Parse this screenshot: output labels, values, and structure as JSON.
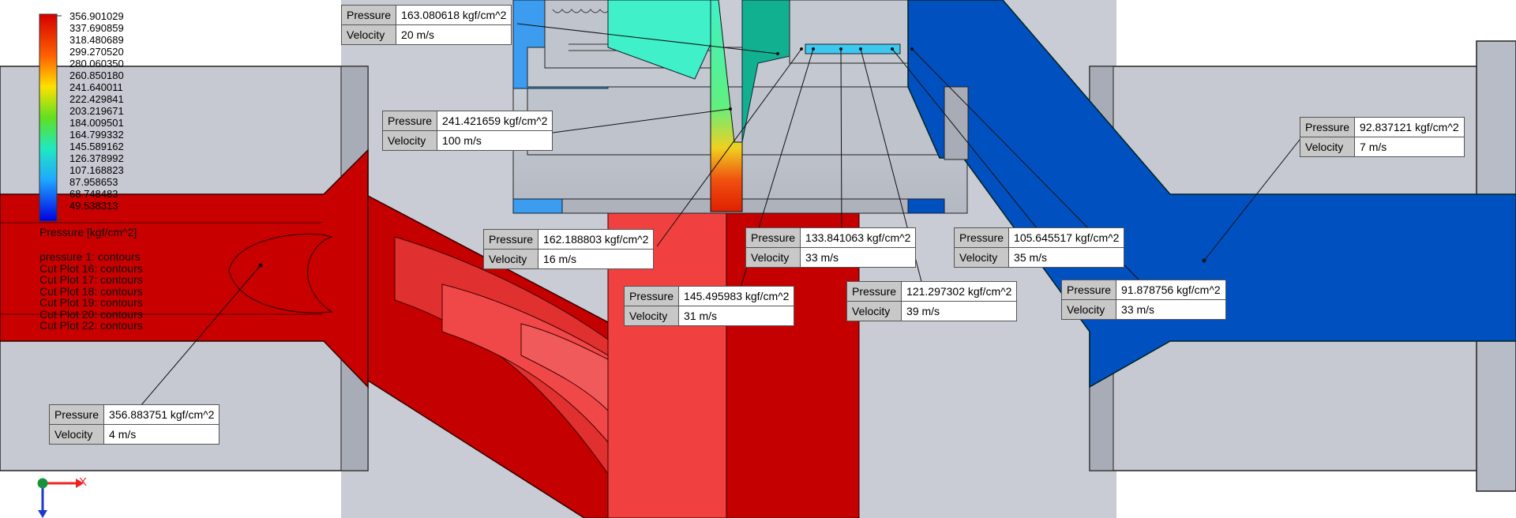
{
  "legend": {
    "values": [
      "356.901029",
      "337.690859",
      "318.480689",
      "299.270520",
      "280.060350",
      "260.850180",
      "241.640011",
      "222.429841",
      "203.219671",
      "184.009501",
      "164.799332",
      "145.589162",
      "126.378992",
      "107.168823",
      "87.958653",
      "68.748483",
      "49.538313"
    ],
    "title": "Pressure [kgf/cm^2]",
    "plots": [
      "pressure 1: contours",
      "Cut Plot 16: contours",
      "Cut Plot 17: contours",
      "Cut Plot 18: contours",
      "Cut Plot 19: contours",
      "Cut Plot 20: contours",
      "Cut Plot 22: contours"
    ]
  },
  "callouts": [
    {
      "pressure_label": "Pressure",
      "pressure": "163.080618 kgf/cm^2",
      "velocity_label": "Velocity",
      "velocity": "20 m/s"
    },
    {
      "pressure_label": "Pressure",
      "pressure": "241.421659 kgf/cm^2",
      "velocity_label": "Velocity",
      "velocity": "100 m/s"
    },
    {
      "pressure_label": "Pressure",
      "pressure": "162.188803 kgf/cm^2",
      "velocity_label": "Velocity",
      "velocity": "16 m/s"
    },
    {
      "pressure_label": "Pressure",
      "pressure": "145.495983 kgf/cm^2",
      "velocity_label": "Velocity",
      "velocity": "31 m/s"
    },
    {
      "pressure_label": "Pressure",
      "pressure": "133.841063 kgf/cm^2",
      "velocity_label": "Velocity",
      "velocity": "33 m/s"
    },
    {
      "pressure_label": "Pressure",
      "pressure": "121.297302 kgf/cm^2",
      "velocity_label": "Velocity",
      "velocity": "39 m/s"
    },
    {
      "pressure_label": "Pressure",
      "pressure": "105.645517 kgf/cm^2",
      "velocity_label": "Velocity",
      "velocity": "35 m/s"
    },
    {
      "pressure_label": "Pressure",
      "pressure": "91.878756 kgf/cm^2",
      "velocity_label": "Velocity",
      "velocity": "33 m/s"
    },
    {
      "pressure_label": "Pressure",
      "pressure": "92.837121 kgf/cm^2",
      "velocity_label": "Velocity",
      "velocity": "7 m/s"
    },
    {
      "pressure_label": "Pressure",
      "pressure": "356.883751 kgf/cm^2",
      "velocity_label": "Velocity",
      "velocity": "4 m/s"
    }
  ],
  "triad": {
    "x_label": "X"
  },
  "colors": {
    "high": "#c80000",
    "mid_red": "#f04040",
    "cyan": "#40f0c8",
    "blue": "#0050c0",
    "light_blue": "#3c9cf0",
    "steel": "#c4c8d0"
  }
}
